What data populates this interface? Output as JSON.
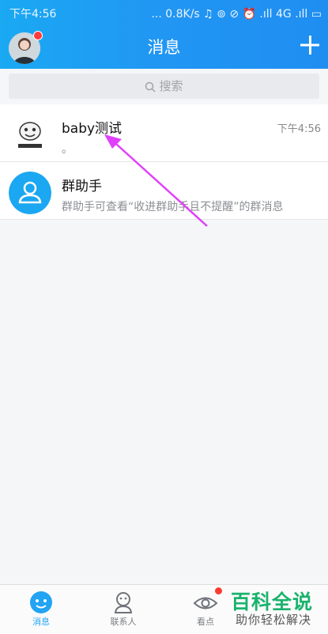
{
  "status_bar": {
    "time": "下午4:56",
    "right": "... 0.8K/s ♫ ⊚ ⊘ ⏰ .ıll 4G .ıll ▭"
  },
  "header": {
    "title": "消息"
  },
  "search": {
    "placeholder": "搜索"
  },
  "conversations": [
    {
      "name": "baby测试",
      "preview": "。",
      "time": "下午4:56",
      "avatar_icon": "cartoon-avatar-icon"
    },
    {
      "name": "群助手",
      "preview": "群助手可查看“收进群助手且不提醒”的群消息",
      "time": "",
      "avatar_icon": "group-assistant-icon"
    }
  ],
  "tabs": [
    {
      "label": "消息",
      "active": true
    },
    {
      "label": "联系人",
      "active": false
    },
    {
      "label": "看点",
      "active": false
    }
  ],
  "watermark": {
    "main": "百科全说",
    "sub": "助你轻松解决"
  },
  "colors": {
    "header": "#2196f3",
    "accent": "#22a3f3",
    "arrow": "#e040fb",
    "badge": "#ff3b30",
    "watermark": "#19b36b"
  }
}
